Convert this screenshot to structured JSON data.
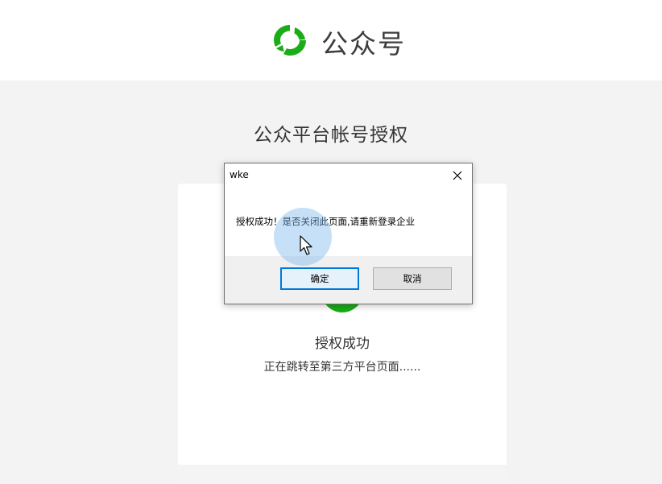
{
  "header": {
    "brand_name": "公众号"
  },
  "page": {
    "title": "公众平台帐号授权"
  },
  "card": {
    "success_title": "授权成功",
    "redirect_text": "正在跳转至第三方平台页面......"
  },
  "dialog": {
    "title": "wke",
    "message": "授权成功！是否关闭此页面,请重新登录企业",
    "ok_label": "确定",
    "cancel_label": "取消"
  },
  "colors": {
    "brand_green": "#1aad19",
    "focus_blue": "#0078d7",
    "cursor_highlight": "#78b4eb"
  },
  "icons": {
    "logo": "wechat-official-account-logo-icon",
    "close": "close-icon",
    "cursor": "mouse-pointer-icon",
    "success": "check-circle-icon"
  }
}
